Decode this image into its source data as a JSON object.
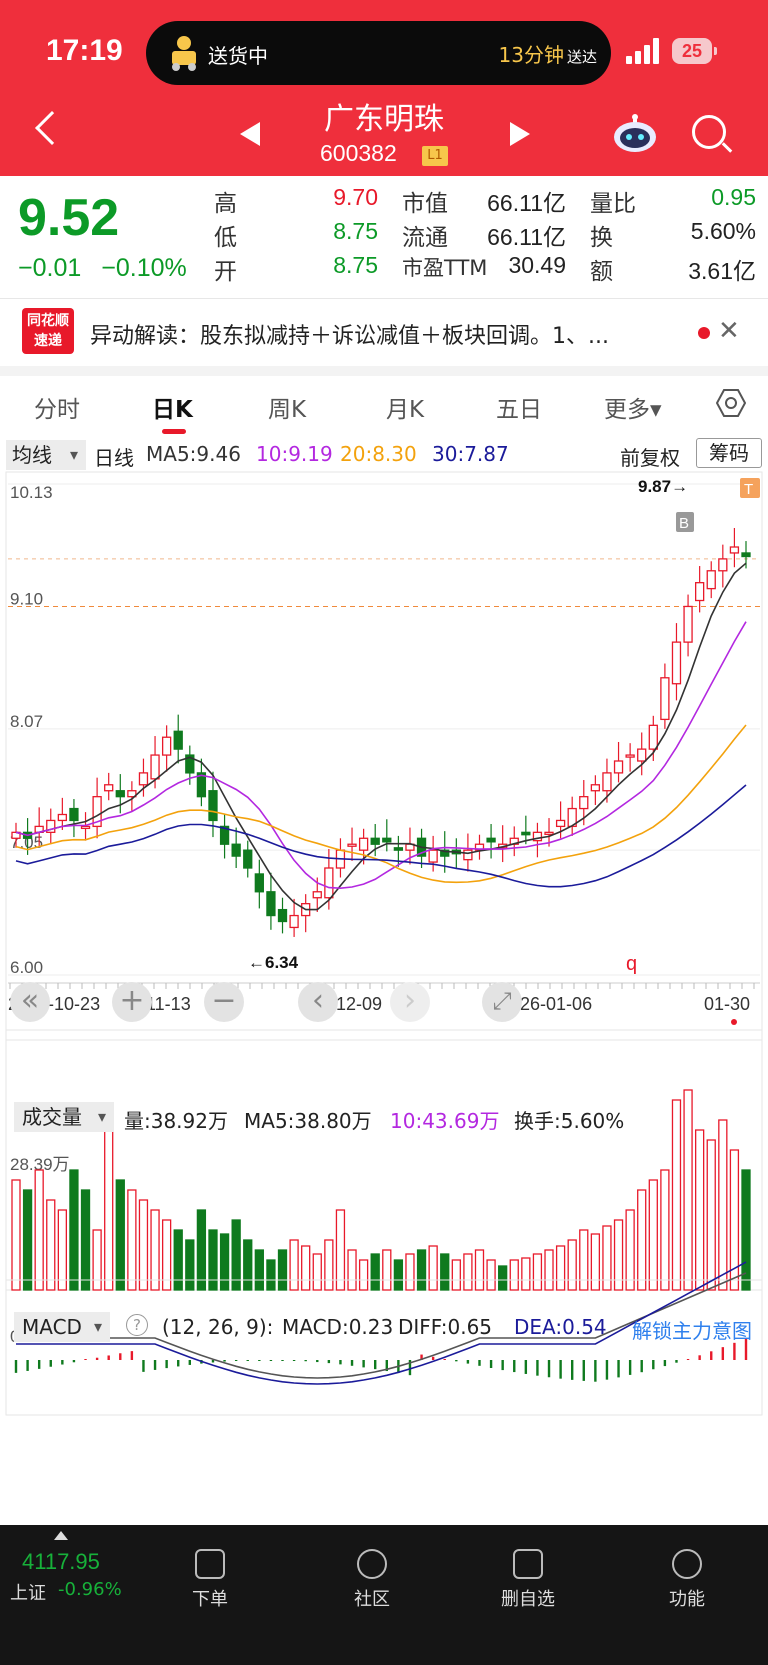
{
  "status": {
    "time": "17:19",
    "delivery": "送货中",
    "eta": "13分钟",
    "eta_suffix": "送达",
    "battery": "25"
  },
  "header": {
    "name": "广东明珠",
    "code": "600382",
    "level": "L1"
  },
  "quote": {
    "price": "9.52",
    "change": "−0.01",
    "change_pct": "−0.10%",
    "labels": {
      "high": "高",
      "low": "低",
      "open": "开",
      "mkt_cap": "市值",
      "float_cap": "流通",
      "pe": "市盈TTM",
      "vol_ratio": "量比",
      "turnover": "换",
      "amount": "额"
    },
    "values": {
      "high": "9.70",
      "low": "8.75",
      "open": "8.75",
      "mkt_cap": "66.11亿",
      "float_cap": "66.11亿",
      "pe": "30.49",
      "vol_ratio": "0.95",
      "turnover": "5.60%",
      "amount": "3.61亿"
    }
  },
  "news": {
    "logo_top": "同花顺",
    "logo_bottom": "速递",
    "text": "异动解读：股东拟减持＋诉讼减值＋板块回调。1、..."
  },
  "tabs": [
    "分时",
    "日K",
    "周K",
    "月K",
    "五日",
    "更多▾"
  ],
  "legend": {
    "select": "均线",
    "period": "日线",
    "ma5": "MA5:9.46",
    "ma10": "10:9.19",
    "ma20": "20:8.30",
    "ma30": "30:7.87",
    "adjust": "前复权",
    "chips": "筹码",
    "colors": {
      "ma5": "#333333",
      "ma10": "#b328e0",
      "ma20": "#f3a20d",
      "ma30": "#1b1b9a"
    }
  },
  "kchart": {
    "y_labels": [
      "10.13",
      "9.10",
      "8.07",
      "7.05",
      "6.00"
    ],
    "max_label": "9.87→",
    "min_label": "←6.34",
    "dates": [
      "2025-10-23",
      "11-13",
      "12-09",
      "2026-01-06",
      "01-30"
    ],
    "markers": {
      "b": "B",
      "t": "T",
      "q": "q"
    }
  },
  "toolbar": {
    "zoom_out": "«",
    "plus": "+",
    "minus": "−",
    "prev": "‹",
    "next": "›",
    "fullscreen": "⤢"
  },
  "volume": {
    "select": "成交量",
    "vol": "量:38.92万",
    "ma5": "MA5:38.80万",
    "ma10": "10:43.69万",
    "turnover": "换手:5.60%",
    "axis": "28.39万"
  },
  "macd": {
    "select": "MACD",
    "params": "(12, 26, 9):",
    "macd": "MACD:0.23",
    "diff": "DIFF:0.65",
    "dea": "DEA:0.54",
    "unlock": "解锁主力意图",
    "axis": "0.18"
  },
  "bottom": {
    "index_value": "4117.95",
    "index_name": "上证",
    "index_chg": "-0.96%",
    "items": [
      "下单",
      "社区",
      "删自选",
      "功能"
    ]
  }
}
